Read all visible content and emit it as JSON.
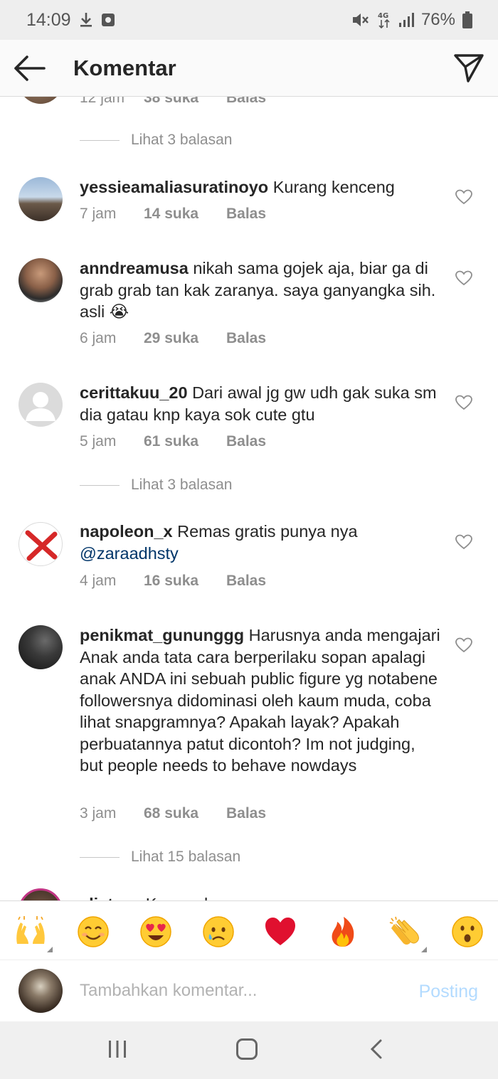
{
  "status_bar": {
    "time": "14:09",
    "battery": "76%",
    "network": "4G",
    "icons": [
      "download-icon",
      "screenshot-icon",
      "mute-icon",
      "signal-icon",
      "battery-icon"
    ]
  },
  "header": {
    "title": "Komentar",
    "back_icon": "arrow-left-icon",
    "send_icon": "direct-send-icon"
  },
  "partial_top_comment": {
    "time": "12 jam",
    "likes": "38 suka",
    "reply": "Balas"
  },
  "comments": [
    {
      "username": "yessieamaliasuratinoyo",
      "text": "Kurang kenceng",
      "time": "7 jam",
      "likes": "14 suka",
      "reply": "Balas"
    },
    {
      "username": "anndreamusa",
      "text": "nikah sama gojek aja, biar ga di grab grab tan kak zaranya. saya ganyangka sih. asli 😭",
      "time": "6 jam",
      "likes": "29 suka",
      "reply": "Balas"
    },
    {
      "username": "cerittakuu_20",
      "text": "Dari awal jg gw udh gak suka sm dia gatau knp kaya sok cute gtu",
      "time": "5 jam",
      "likes": "61 suka",
      "reply": "Balas"
    },
    {
      "username": "napoleon_x",
      "text": "Remas gratis punya nya",
      "mention": "@zaraadhsty",
      "time": "4 jam",
      "likes": "16 suka",
      "reply": "Balas"
    },
    {
      "username": "penikmat_gununggg",
      "text": "Harusnya anda mengajari Anak anda tata cara berperilaku sopan apalagi anak ANDA ini sebuah public figure yg notabene followersnya didominasi oleh kaum muda, coba lihat snapgramnya? Apakah layak? Apakah perbuatannya patut dicontoh? Im not judging, but people needs to behave nowdays",
      "time": "3 jam",
      "likes": "68 suka",
      "reply": "Balas"
    }
  ],
  "view_replies": [
    "Lihat 3 balasan",
    "Lihat 3 balasan",
    "Lihat 15 balasan"
  ],
  "partial_bottom_comment": {
    "username": "elistzen",
    "text": "Kurang keras remasnya"
  },
  "emoji_bar": [
    "🙌",
    "😊",
    "😍",
    "😢",
    "❤️",
    "🔥",
    "👏",
    "😮"
  ],
  "composer": {
    "placeholder": "Tambahkan komentar...",
    "post_label": "Posting"
  },
  "colors": {
    "mention": "#003569",
    "post_disabled": "#b3dbff",
    "meta_gray": "#8e8e8e",
    "text": "#262626"
  }
}
